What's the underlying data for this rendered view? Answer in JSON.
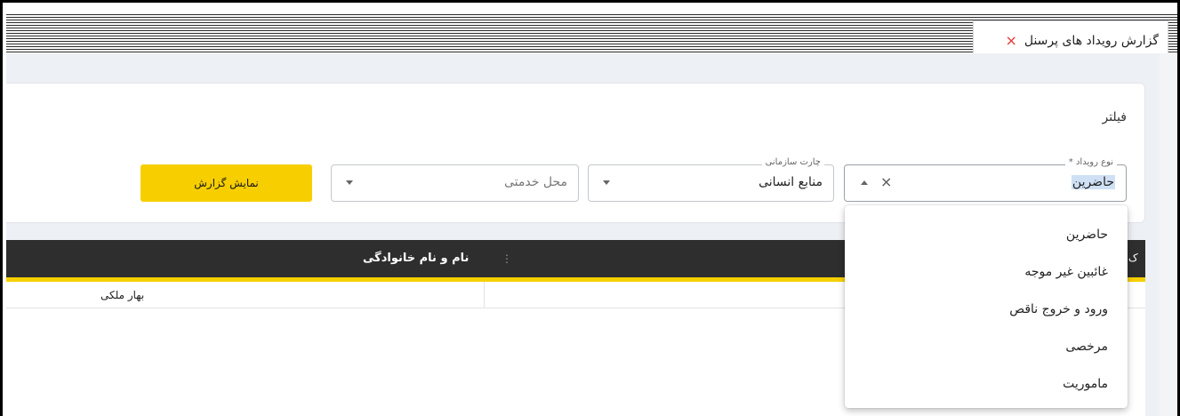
{
  "tab": {
    "title": "گزارش رویداد های پرسنل",
    "close": "×"
  },
  "filter": {
    "title": "فیلتر",
    "event_type": {
      "legend": "نوع رویداد *",
      "value": "حاضرین",
      "clear": "×"
    },
    "org_chart": {
      "legend": "چارت سازمانی",
      "value": "منابع انسانی"
    },
    "service_place": {
      "placeholder": "محل خدمتی"
    },
    "show_report_label": "نمایش گزارش"
  },
  "grid": {
    "column_header": "نام و نام خانوادگی",
    "menu_glyph": "⋮",
    "cut_header": "ک",
    "rows": [
      {
        "name": "بهار ملکی"
      }
    ]
  },
  "dropdown": {
    "options": [
      "حاضرین",
      "غائبین غیر موجه",
      "ورود و خروج ناقص",
      "مرخصی",
      "ماموریت"
    ]
  },
  "colors": {
    "accent": "#f7cf00",
    "header_bg": "#2e2e2e",
    "close": "#e53935"
  }
}
